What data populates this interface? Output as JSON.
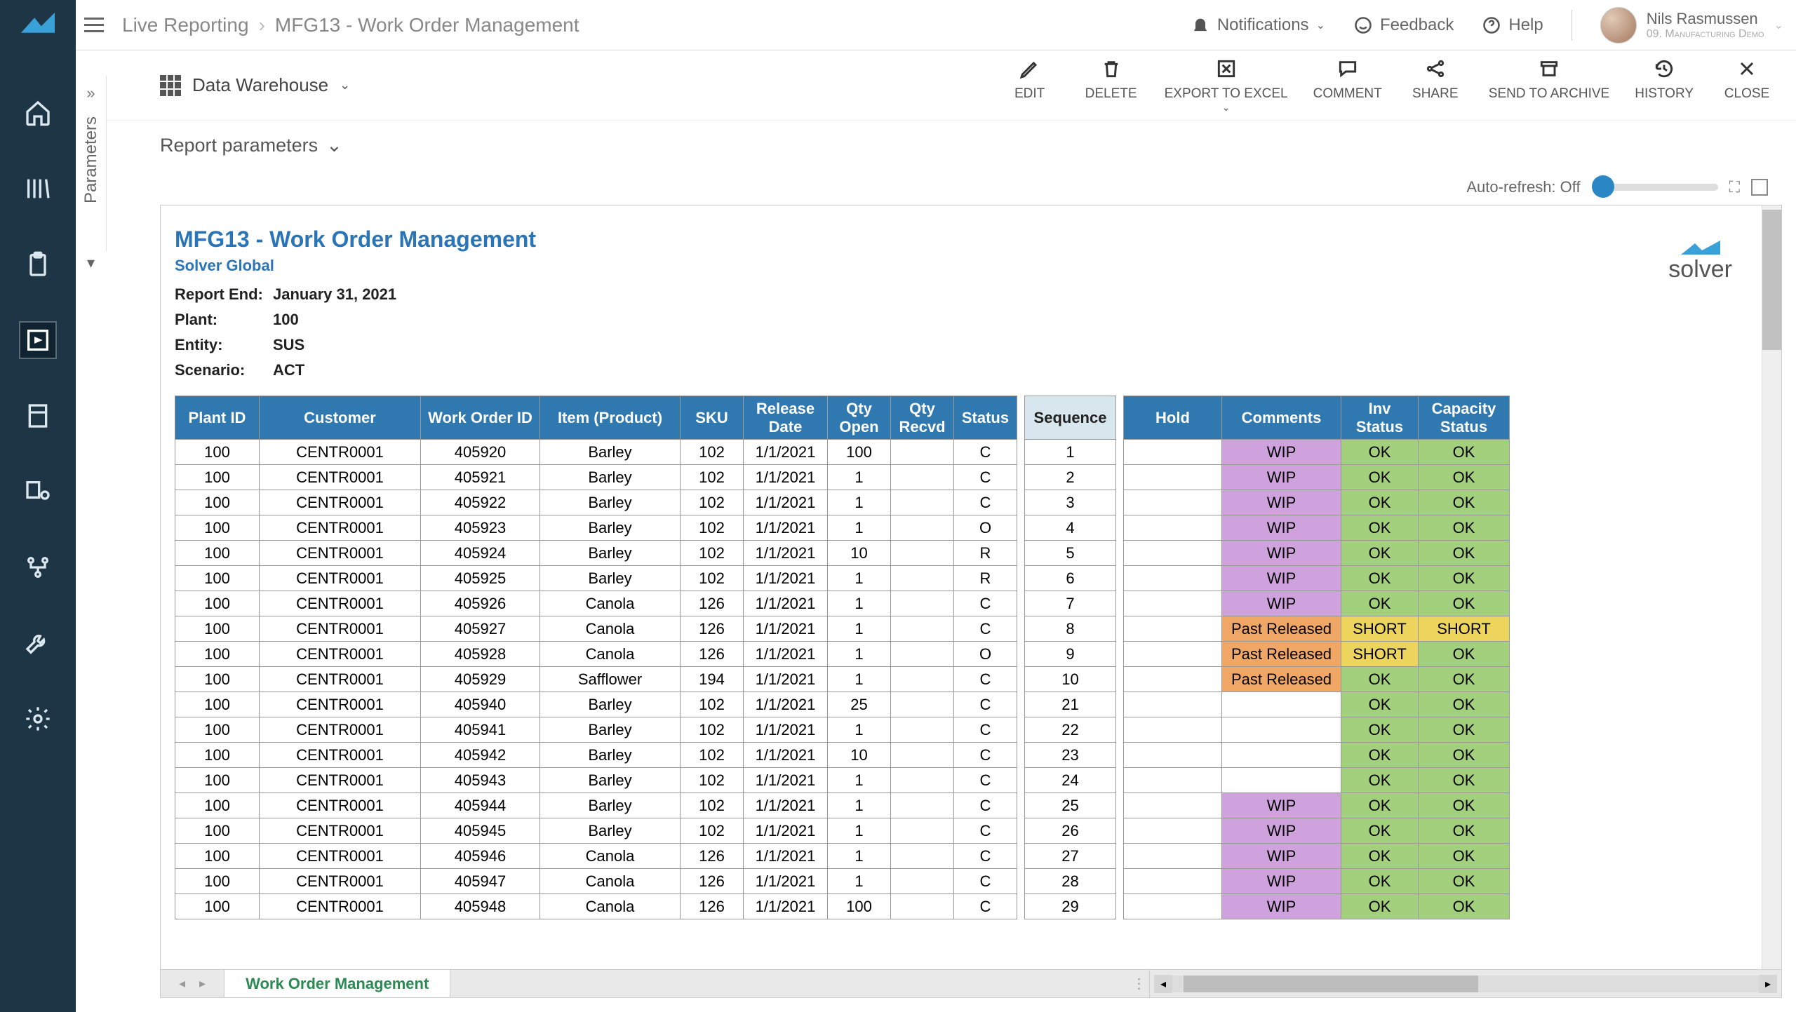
{
  "breadcrumb": {
    "root": "Live Reporting",
    "current": "MFG13 - Work Order Management"
  },
  "user": {
    "name": "Nils Rasmussen",
    "role": "09. Manufacturing Demo"
  },
  "top_actions": {
    "notifications": "Notifications",
    "feedback": "Feedback",
    "help": "Help"
  },
  "parameters_label": "Parameters",
  "datasource": {
    "label": "Data Warehouse"
  },
  "tools": {
    "edit": "EDIT",
    "delete": "DELETE",
    "export": "EXPORT TO EXCEL",
    "comment": "COMMENT",
    "share": "SHARE",
    "archive": "SEND TO ARCHIVE",
    "history": "HISTORY",
    "close": "CLOSE"
  },
  "report_params_label": "Report parameters",
  "auto_refresh_label": "Auto-refresh: Off",
  "report": {
    "title": "MFG13 - Work Order Management",
    "subtitle": "Solver Global",
    "meta": [
      {
        "k": "Report End:",
        "v": "January 31, 2021"
      },
      {
        "k": "Plant:",
        "v": "100"
      },
      {
        "k": "Entity:",
        "v": "SUS"
      },
      {
        "k": "Scenario:",
        "v": "ACT"
      }
    ],
    "brand": "solver"
  },
  "headers1": [
    "Plant ID",
    "Customer",
    "Work Order ID",
    "Item (Product)",
    "SKU",
    "Release Date",
    "Qty Open",
    "Qty Recvd",
    "Status"
  ],
  "headers2": [
    "Sequence"
  ],
  "headers3": [
    "Hold",
    "Comments",
    "Inv Status",
    "Capacity Status"
  ],
  "rows": [
    {
      "plant": "100",
      "cust": "CENTR0001",
      "wo": "405920",
      "item": "Barley",
      "sku": "102",
      "rd": "1/1/2021",
      "qo": "100",
      "qr": "",
      "st": "C",
      "seq": "1",
      "hold": "",
      "com": "WIP",
      "inv": "OK",
      "cap": "OK"
    },
    {
      "plant": "100",
      "cust": "CENTR0001",
      "wo": "405921",
      "item": "Barley",
      "sku": "102",
      "rd": "1/1/2021",
      "qo": "1",
      "qr": "",
      "st": "C",
      "seq": "2",
      "hold": "",
      "com": "WIP",
      "inv": "OK",
      "cap": "OK"
    },
    {
      "plant": "100",
      "cust": "CENTR0001",
      "wo": "405922",
      "item": "Barley",
      "sku": "102",
      "rd": "1/1/2021",
      "qo": "1",
      "qr": "",
      "st": "C",
      "seq": "3",
      "hold": "",
      "com": "WIP",
      "inv": "OK",
      "cap": "OK"
    },
    {
      "plant": "100",
      "cust": "CENTR0001",
      "wo": "405923",
      "item": "Barley",
      "sku": "102",
      "rd": "1/1/2021",
      "qo": "1",
      "qr": "",
      "st": "O",
      "seq": "4",
      "hold": "",
      "com": "WIP",
      "inv": "OK",
      "cap": "OK"
    },
    {
      "plant": "100",
      "cust": "CENTR0001",
      "wo": "405924",
      "item": "Barley",
      "sku": "102",
      "rd": "1/1/2021",
      "qo": "10",
      "qr": "",
      "st": "R",
      "seq": "5",
      "hold": "",
      "com": "WIP",
      "inv": "OK",
      "cap": "OK"
    },
    {
      "plant": "100",
      "cust": "CENTR0001",
      "wo": "405925",
      "item": "Barley",
      "sku": "102",
      "rd": "1/1/2021",
      "qo": "1",
      "qr": "",
      "st": "R",
      "seq": "6",
      "hold": "",
      "com": "WIP",
      "inv": "OK",
      "cap": "OK"
    },
    {
      "plant": "100",
      "cust": "CENTR0001",
      "wo": "405926",
      "item": "Canola",
      "sku": "126",
      "rd": "1/1/2021",
      "qo": "1",
      "qr": "",
      "st": "C",
      "seq": "7",
      "hold": "",
      "com": "WIP",
      "inv": "OK",
      "cap": "OK"
    },
    {
      "plant": "100",
      "cust": "CENTR0001",
      "wo": "405927",
      "item": "Canola",
      "sku": "126",
      "rd": "1/1/2021",
      "qo": "1",
      "qr": "",
      "st": "C",
      "seq": "8",
      "hold": "",
      "com": "Past Released",
      "inv": "SHORT",
      "cap": "SHORT"
    },
    {
      "plant": "100",
      "cust": "CENTR0001",
      "wo": "405928",
      "item": "Canola",
      "sku": "126",
      "rd": "1/1/2021",
      "qo": "1",
      "qr": "",
      "st": "O",
      "seq": "9",
      "hold": "",
      "com": "Past Released",
      "inv": "SHORT",
      "cap": "OK"
    },
    {
      "plant": "100",
      "cust": "CENTR0001",
      "wo": "405929",
      "item": "Safflower",
      "sku": "194",
      "rd": "1/1/2021",
      "qo": "1",
      "qr": "",
      "st": "C",
      "seq": "10",
      "hold": "",
      "com": "Past Released",
      "inv": "OK",
      "cap": "OK"
    },
    {
      "plant": "100",
      "cust": "CENTR0001",
      "wo": "405940",
      "item": "Barley",
      "sku": "102",
      "rd": "1/1/2021",
      "qo": "25",
      "qr": "",
      "st": "C",
      "seq": "21",
      "hold": "",
      "com": "",
      "inv": "OK",
      "cap": "OK"
    },
    {
      "plant": "100",
      "cust": "CENTR0001",
      "wo": "405941",
      "item": "Barley",
      "sku": "102",
      "rd": "1/1/2021",
      "qo": "1",
      "qr": "",
      "st": "C",
      "seq": "22",
      "hold": "",
      "com": "",
      "inv": "OK",
      "cap": "OK"
    },
    {
      "plant": "100",
      "cust": "CENTR0001",
      "wo": "405942",
      "item": "Barley",
      "sku": "102",
      "rd": "1/1/2021",
      "qo": "10",
      "qr": "",
      "st": "C",
      "seq": "23",
      "hold": "",
      "com": "",
      "inv": "OK",
      "cap": "OK"
    },
    {
      "plant": "100",
      "cust": "CENTR0001",
      "wo": "405943",
      "item": "Barley",
      "sku": "102",
      "rd": "1/1/2021",
      "qo": "1",
      "qr": "",
      "st": "C",
      "seq": "24",
      "hold": "",
      "com": "",
      "inv": "OK",
      "cap": "OK"
    },
    {
      "plant": "100",
      "cust": "CENTR0001",
      "wo": "405944",
      "item": "Barley",
      "sku": "102",
      "rd": "1/1/2021",
      "qo": "1",
      "qr": "",
      "st": "C",
      "seq": "25",
      "hold": "",
      "com": "WIP",
      "inv": "OK",
      "cap": "OK"
    },
    {
      "plant": "100",
      "cust": "CENTR0001",
      "wo": "405945",
      "item": "Barley",
      "sku": "102",
      "rd": "1/1/2021",
      "qo": "1",
      "qr": "",
      "st": "C",
      "seq": "26",
      "hold": "",
      "com": "WIP",
      "inv": "OK",
      "cap": "OK"
    },
    {
      "plant": "100",
      "cust": "CENTR0001",
      "wo": "405946",
      "item": "Canola",
      "sku": "126",
      "rd": "1/1/2021",
      "qo": "1",
      "qr": "",
      "st": "C",
      "seq": "27",
      "hold": "",
      "com": "WIP",
      "inv": "OK",
      "cap": "OK"
    },
    {
      "plant": "100",
      "cust": "CENTR0001",
      "wo": "405947",
      "item": "Canola",
      "sku": "126",
      "rd": "1/1/2021",
      "qo": "1",
      "qr": "",
      "st": "C",
      "seq": "28",
      "hold": "",
      "com": "WIP",
      "inv": "OK",
      "cap": "OK"
    },
    {
      "plant": "100",
      "cust": "CENTR0001",
      "wo": "405948",
      "item": "Canola",
      "sku": "126",
      "rd": "1/1/2021",
      "qo": "100",
      "qr": "",
      "st": "C",
      "seq": "29",
      "hold": "",
      "com": "WIP",
      "inv": "OK",
      "cap": "OK"
    }
  ],
  "sheet_tab": "Work Order Management"
}
